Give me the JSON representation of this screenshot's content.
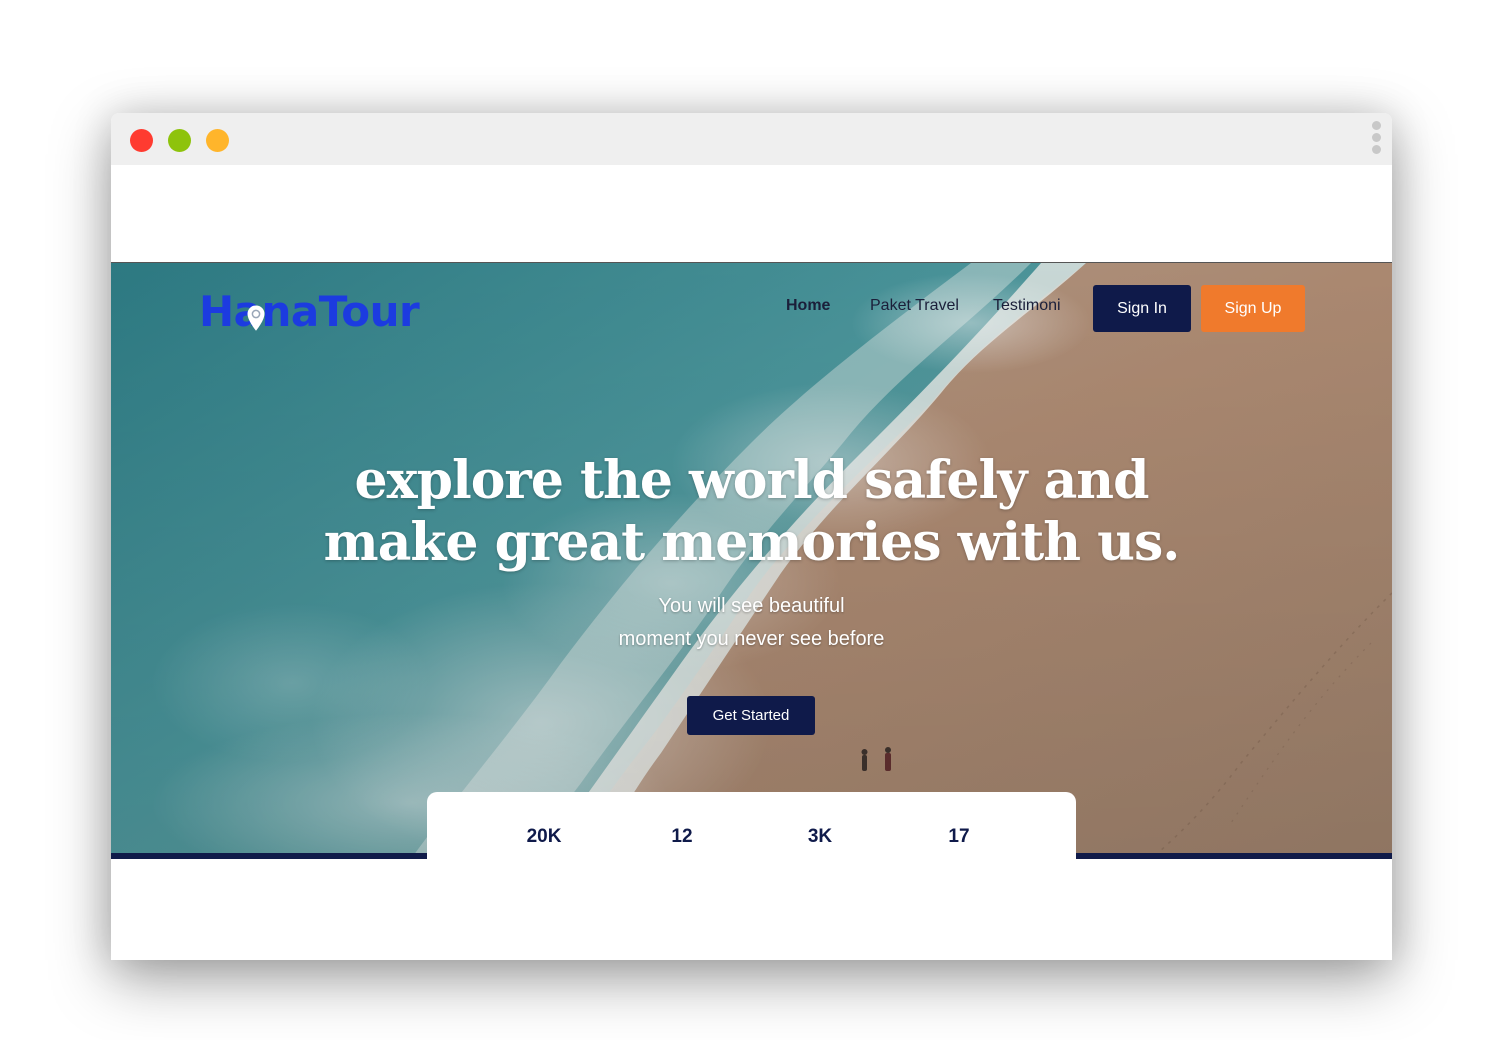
{
  "brand": {
    "name": "HanaTour",
    "color": "#1c3be0"
  },
  "nav": {
    "home": "Home",
    "paket": "Paket Travel",
    "testimoni": "Testimoni"
  },
  "auth": {
    "sign_in": "Sign In",
    "sign_up": "Sign Up"
  },
  "hero": {
    "headline_line1": "explore the world safely and",
    "headline_line2": "make great memories with us.",
    "subline_line1": "You will see beautiful",
    "subline_line2": "moment you never see before",
    "cta": "Get Started"
  },
  "stats": [
    "20K",
    "12",
    "3K",
    "17"
  ],
  "colors": {
    "navy": "#0f1a4a",
    "orange": "#f07a2c",
    "close_dot": "#ff3b30",
    "maximize_dot": "#8ec30c",
    "minimize_dot": "#ffb52b"
  },
  "icons": [
    "location-pin-icon",
    "more-vertical-icon"
  ]
}
